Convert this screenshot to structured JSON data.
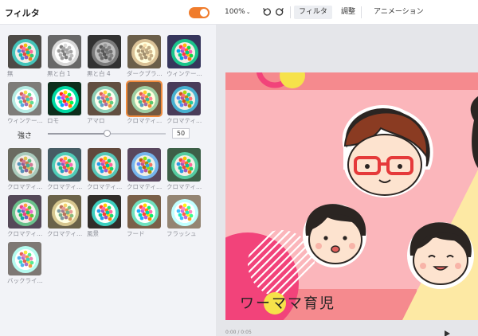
{
  "panel": {
    "title": "フィルタ",
    "toggle_on": true,
    "accent_color": "#f07c2c"
  },
  "filters": {
    "row1": [
      {
        "label": "無",
        "tone": "normal"
      },
      {
        "label": "黒と白 1",
        "tone": "gray"
      },
      {
        "label": "黒と白 4",
        "tone": "gray-dark"
      },
      {
        "label": "ダークブラ...",
        "tone": "sepia"
      },
      {
        "label": "ウィンテー...",
        "tone": "vintage"
      }
    ],
    "row2": [
      {
        "label": "ウィンテー...",
        "tone": "faded"
      },
      {
        "label": "ロモ",
        "tone": "lomo"
      },
      {
        "label": "アマロ",
        "tone": "amaro"
      },
      {
        "label": "クロマティ...",
        "tone": "chroma-warm",
        "selected": true
      },
      {
        "label": "クロマティ...",
        "tone": "chroma-cool"
      }
    ],
    "row3": [
      {
        "label": "クロマティ...",
        "tone": "chroma-a"
      },
      {
        "label": "クロマティ...",
        "tone": "chroma-b"
      },
      {
        "label": "クロマティ...",
        "tone": "chroma-c"
      },
      {
        "label": "クロマティ...",
        "tone": "chroma-d"
      },
      {
        "label": "クロマティ...",
        "tone": "chroma-e"
      }
    ],
    "row4": [
      {
        "label": "クロマティ...",
        "tone": "chroma-f"
      },
      {
        "label": "クロマティ...",
        "tone": "chroma-g"
      },
      {
        "label": "風景",
        "tone": "landscape"
      },
      {
        "label": "フード",
        "tone": "food"
      },
      {
        "label": "フラッシュ",
        "tone": "flash"
      }
    ],
    "row5": [
      {
        "label": "バックライ...",
        "tone": "backlight"
      }
    ]
  },
  "strength": {
    "label": "強さ",
    "value": "50",
    "fraction": 0.5
  },
  "toolbar": {
    "zoom": "100%",
    "undo_icon": "undo-icon",
    "redo_icon": "redo-icon",
    "tabs": [
      "フィルタ",
      "調整",
      "アニメーション"
    ],
    "active_tab": 0
  },
  "slide": {
    "title": "ワーママ育児",
    "timecode": "0:00 / 0:05",
    "bg_color": "#fbb6bb",
    "band_color": "#f58a8e",
    "accent_pink": "#f2437a",
    "accent_yellow": "#f6e24a",
    "accent_cream": "#fde9a4"
  }
}
